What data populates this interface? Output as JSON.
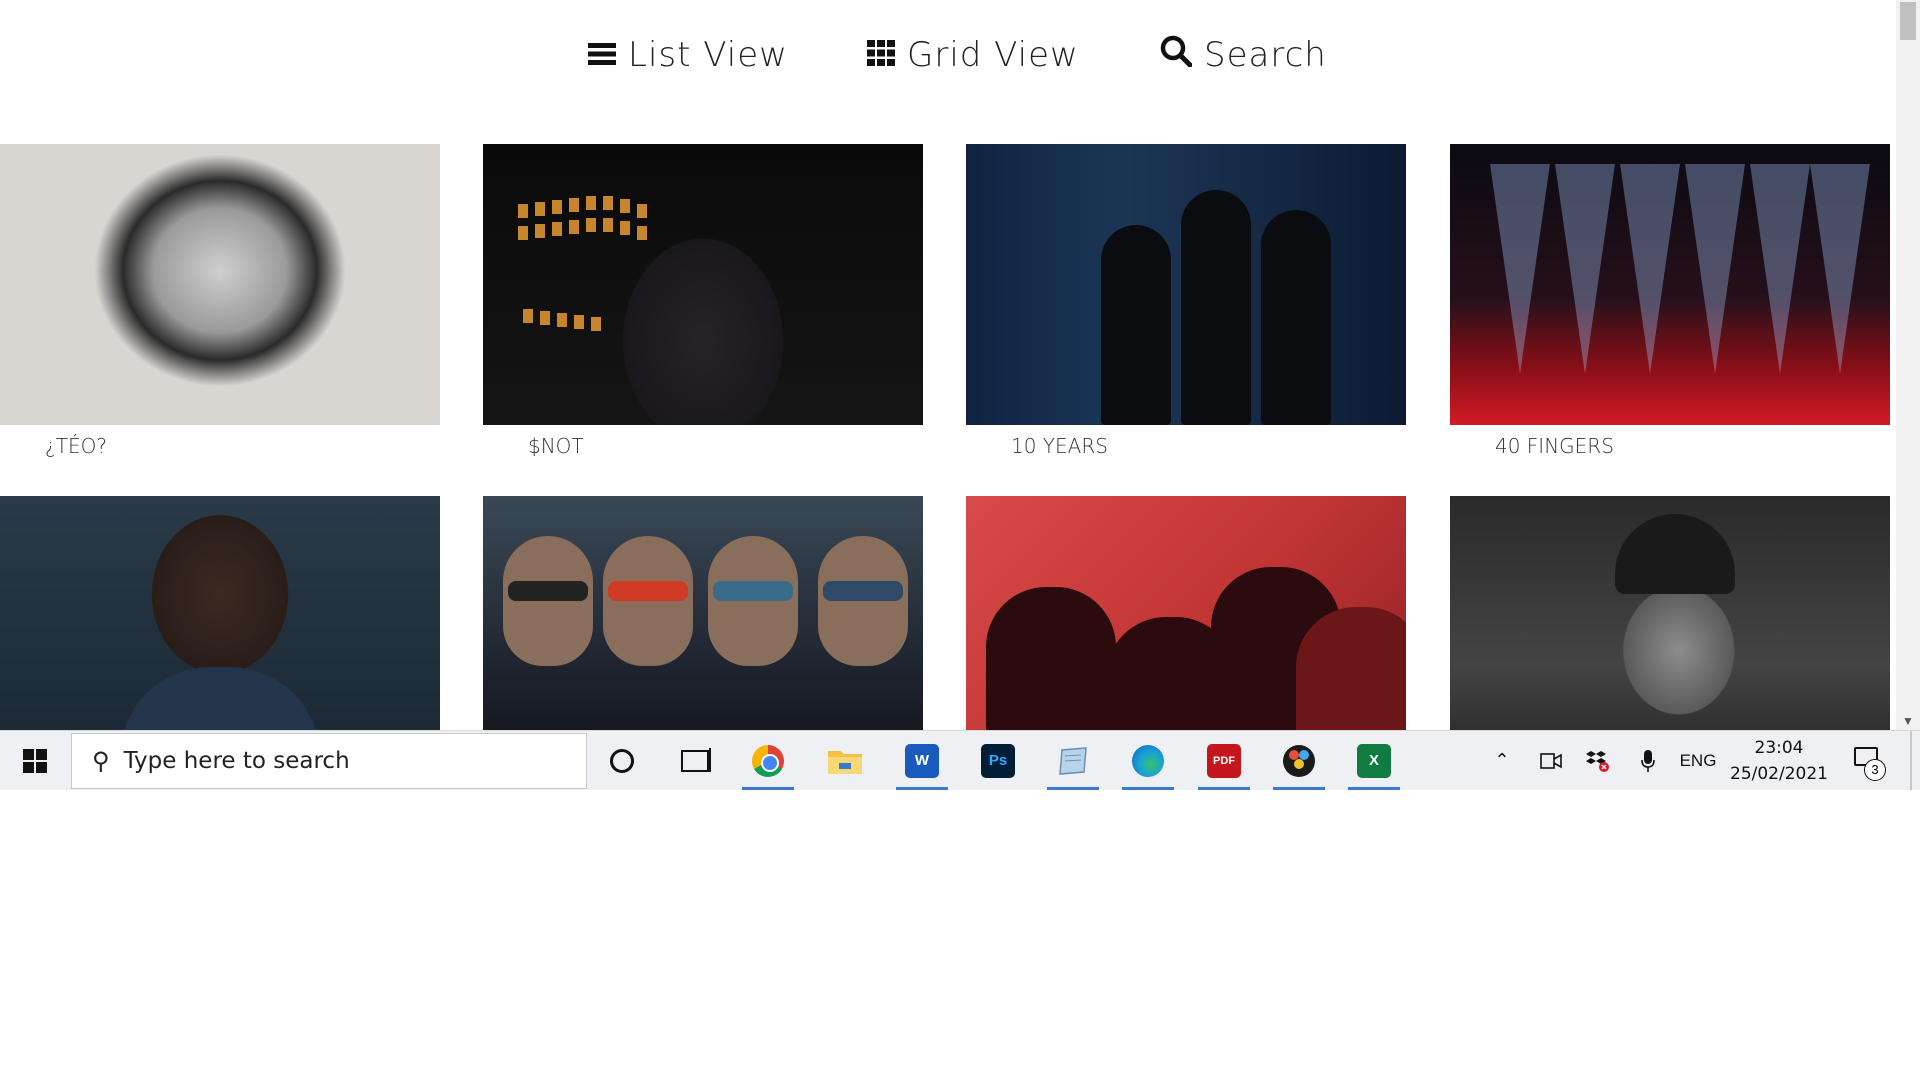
{
  "nav": {
    "list_view": "List View",
    "grid_view": "Grid View",
    "search": "Search"
  },
  "artists": [
    {
      "name": "¿TÉO?"
    },
    {
      "name": "$NOT"
    },
    {
      "name": "10 YEARS"
    },
    {
      "name": "40 FINGERS"
    },
    {
      "name": ""
    },
    {
      "name": ""
    },
    {
      "name": ""
    },
    {
      "name": ""
    }
  ],
  "taskbar": {
    "search_placeholder": "Type here to search",
    "apps": [
      "chrome",
      "file-explorer",
      "word",
      "photoshop",
      "notepad",
      "edge",
      "pdf-xchange",
      "davinci-resolve",
      "excel"
    ],
    "language": "ENG",
    "time": "23:04",
    "date": "25/02/2021",
    "notification_count": "3"
  },
  "colors": {
    "taskbar_bg": "#eef0f3",
    "active_indicator": "#3a78d6",
    "word": "#185abd",
    "photoshop": "#001e36",
    "excel": "#107c41",
    "pdf": "#c4161c"
  }
}
